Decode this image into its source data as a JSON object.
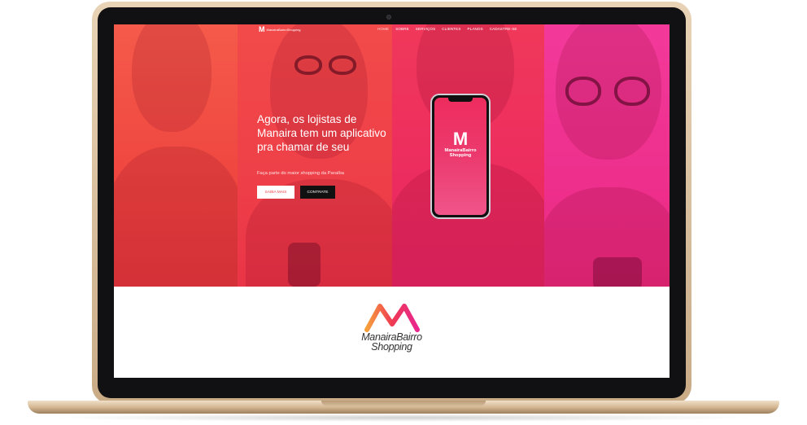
{
  "brand": {
    "nav_logo_mark": "M",
    "nav_logo_text": "ManairaBairroShopping",
    "name_line1": "ManairaBairro",
    "name_line2": "Shopping",
    "colors": {
      "primary": "#ef3a52",
      "gradient_start": "#f6a03c",
      "gradient_end": "#e8268e"
    }
  },
  "nav": {
    "items": [
      {
        "label": "HOME",
        "active": true
      },
      {
        "label": "SOBRE",
        "active": false
      },
      {
        "label": "SERVIÇOS",
        "active": false
      },
      {
        "label": "CLIENTES",
        "active": false
      },
      {
        "label": "PLANOS",
        "active": false
      },
      {
        "label": "CADASTRE-SE",
        "active": false
      }
    ]
  },
  "hero": {
    "headline": "Agora, os lojistas de Manaira tem um aplicativo pra chamar de seu",
    "subtitle": "Faça parte do maior shopping da Paraíba",
    "primary_button": "SAIBA MAIS",
    "secondary_button": "CONTRATE"
  },
  "phone": {
    "logo_mark": "M",
    "line1": "ManairaBairro",
    "line2": "Shopping"
  }
}
